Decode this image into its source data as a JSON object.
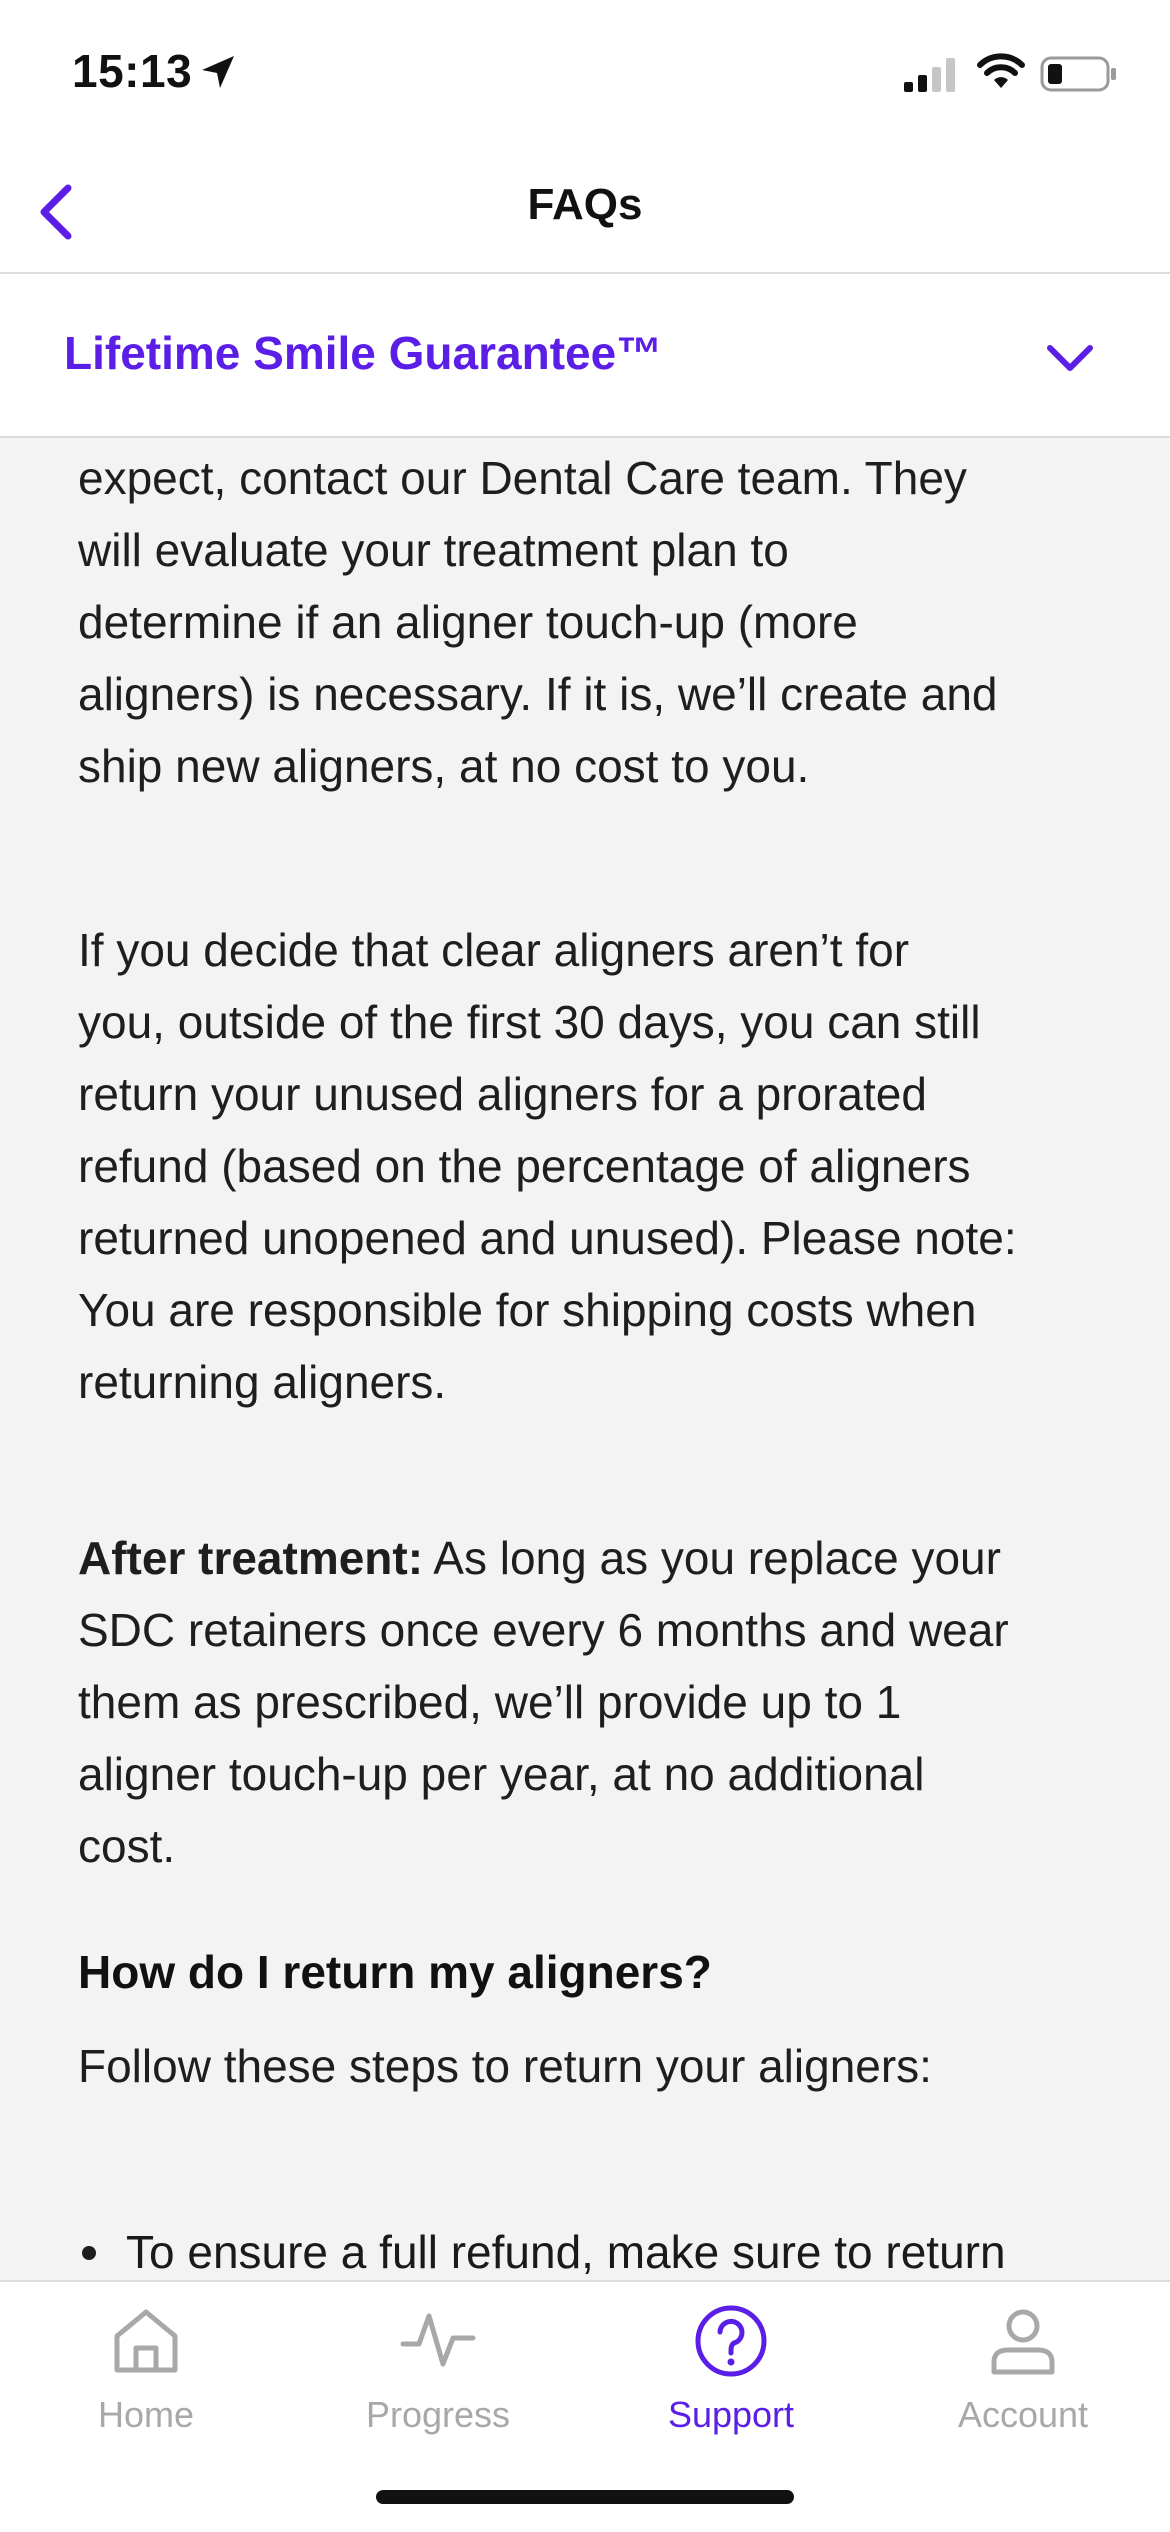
{
  "status_bar": {
    "time": "15:13"
  },
  "header": {
    "title": "FAQs"
  },
  "section": {
    "title": "Lifetime Smile Guarantee™"
  },
  "content": {
    "p1": [
      "expect, contact our Dental Care team. They",
      "will evaluate your treatment plan to",
      "determine if an aligner touch-up (more",
      "aligners) is necessary. If it is, we’ll create and",
      "ship new aligners, at no cost to you."
    ],
    "p2": [
      "If you decide that clear aligners aren’t for",
      "you, outside of the first 30 days, you can still",
      "return your unused aligners for a prorated",
      "refund (based on the percentage of aligners",
      "returned unopened and unused). Please note:",
      "You are responsible for shipping costs when",
      "returning aligners."
    ],
    "p3_bold": "After treatment:",
    "p3_line1_rest": " As long as you replace your",
    "p3": [
      "SDC retainers once every 6 months and wear",
      "them as prescribed, we’ll provide up to 1",
      "aligner touch-up per year, at no additional",
      "cost."
    ],
    "question": "How do I return my aligners?",
    "steps_intro": "Follow these steps to return your aligners:",
    "bullet1": "To ensure a full refund, make sure to return"
  },
  "tabs": [
    {
      "label": "Home",
      "icon": "home-icon",
      "active": false
    },
    {
      "label": "Progress",
      "icon": "pulse-icon",
      "active": false
    },
    {
      "label": "Support",
      "icon": "question-icon",
      "active": true
    },
    {
      "label": "Account",
      "icon": "person-icon",
      "active": false
    }
  ],
  "colors": {
    "accent": "#5a1ee6",
    "inactive": "#a8a8a8",
    "content_bg": "#f3f3f3"
  }
}
